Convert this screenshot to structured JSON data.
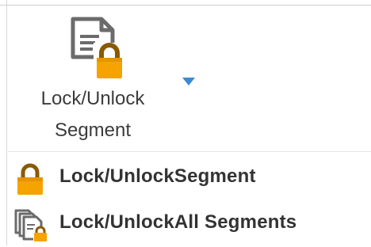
{
  "ribbon": {
    "label_line1": "Lock/Unlock",
    "label_line2": "Segment",
    "icon": "document-lock-icon",
    "dropdown_icon": "dropdown-arrow-icon"
  },
  "menu": {
    "items": [
      {
        "label": "Lock/UnlockSegment",
        "icon": "padlock-icon"
      },
      {
        "label": "Lock/UnlockAll Segments",
        "icon": "multi-document-lock-icon"
      }
    ]
  },
  "colors": {
    "lock_orange": "#f5a300",
    "lock_shackle": "#8a5a00",
    "doc_gray": "#6b6b6b",
    "arrow_blue": "#3a8ad4",
    "text": "#333333"
  }
}
